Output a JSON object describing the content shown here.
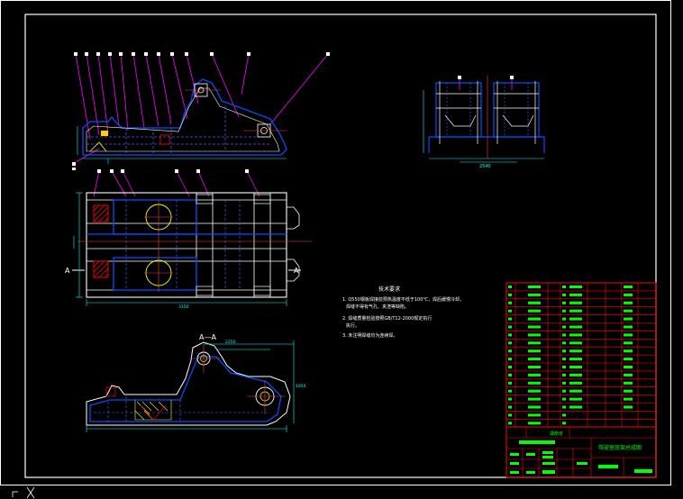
{
  "drawing": {
    "section_label": "A—A",
    "section_mark_left": "A",
    "section_mark_right": "A",
    "notes": {
      "heading": "技术要求",
      "line1": "1. Q550钢板焊接前预热温度不低于100℃，焊后缓慢冷却，",
      "line1b": "焊缝不得有气孔、夹渣等缺陷。",
      "line2": "2. 焊缝质量检验按照GB/T12-2000规定执行",
      "line2b": "执行。",
      "line3": "3. 未注明焊缝均为连续焊。"
    },
    "title_block": {
      "drawing_title": "驾驶室底架总成图",
      "company": "湖南省"
    },
    "dims": {
      "front_width": "1300",
      "side_width": "2540",
      "plan_length": "3150",
      "section_length": "2250",
      "section_height": "1050"
    }
  },
  "colors": {
    "background": "#000000",
    "border": "#ffffff",
    "outline": "#ffffff",
    "dimension": "#00ffff",
    "hidden": "#5a5aff",
    "center": "#ff4040",
    "leader": "#ff00ff",
    "table": "#ff0000",
    "table_text": "#00ff00"
  },
  "ucs_icon": "ucs-icon"
}
